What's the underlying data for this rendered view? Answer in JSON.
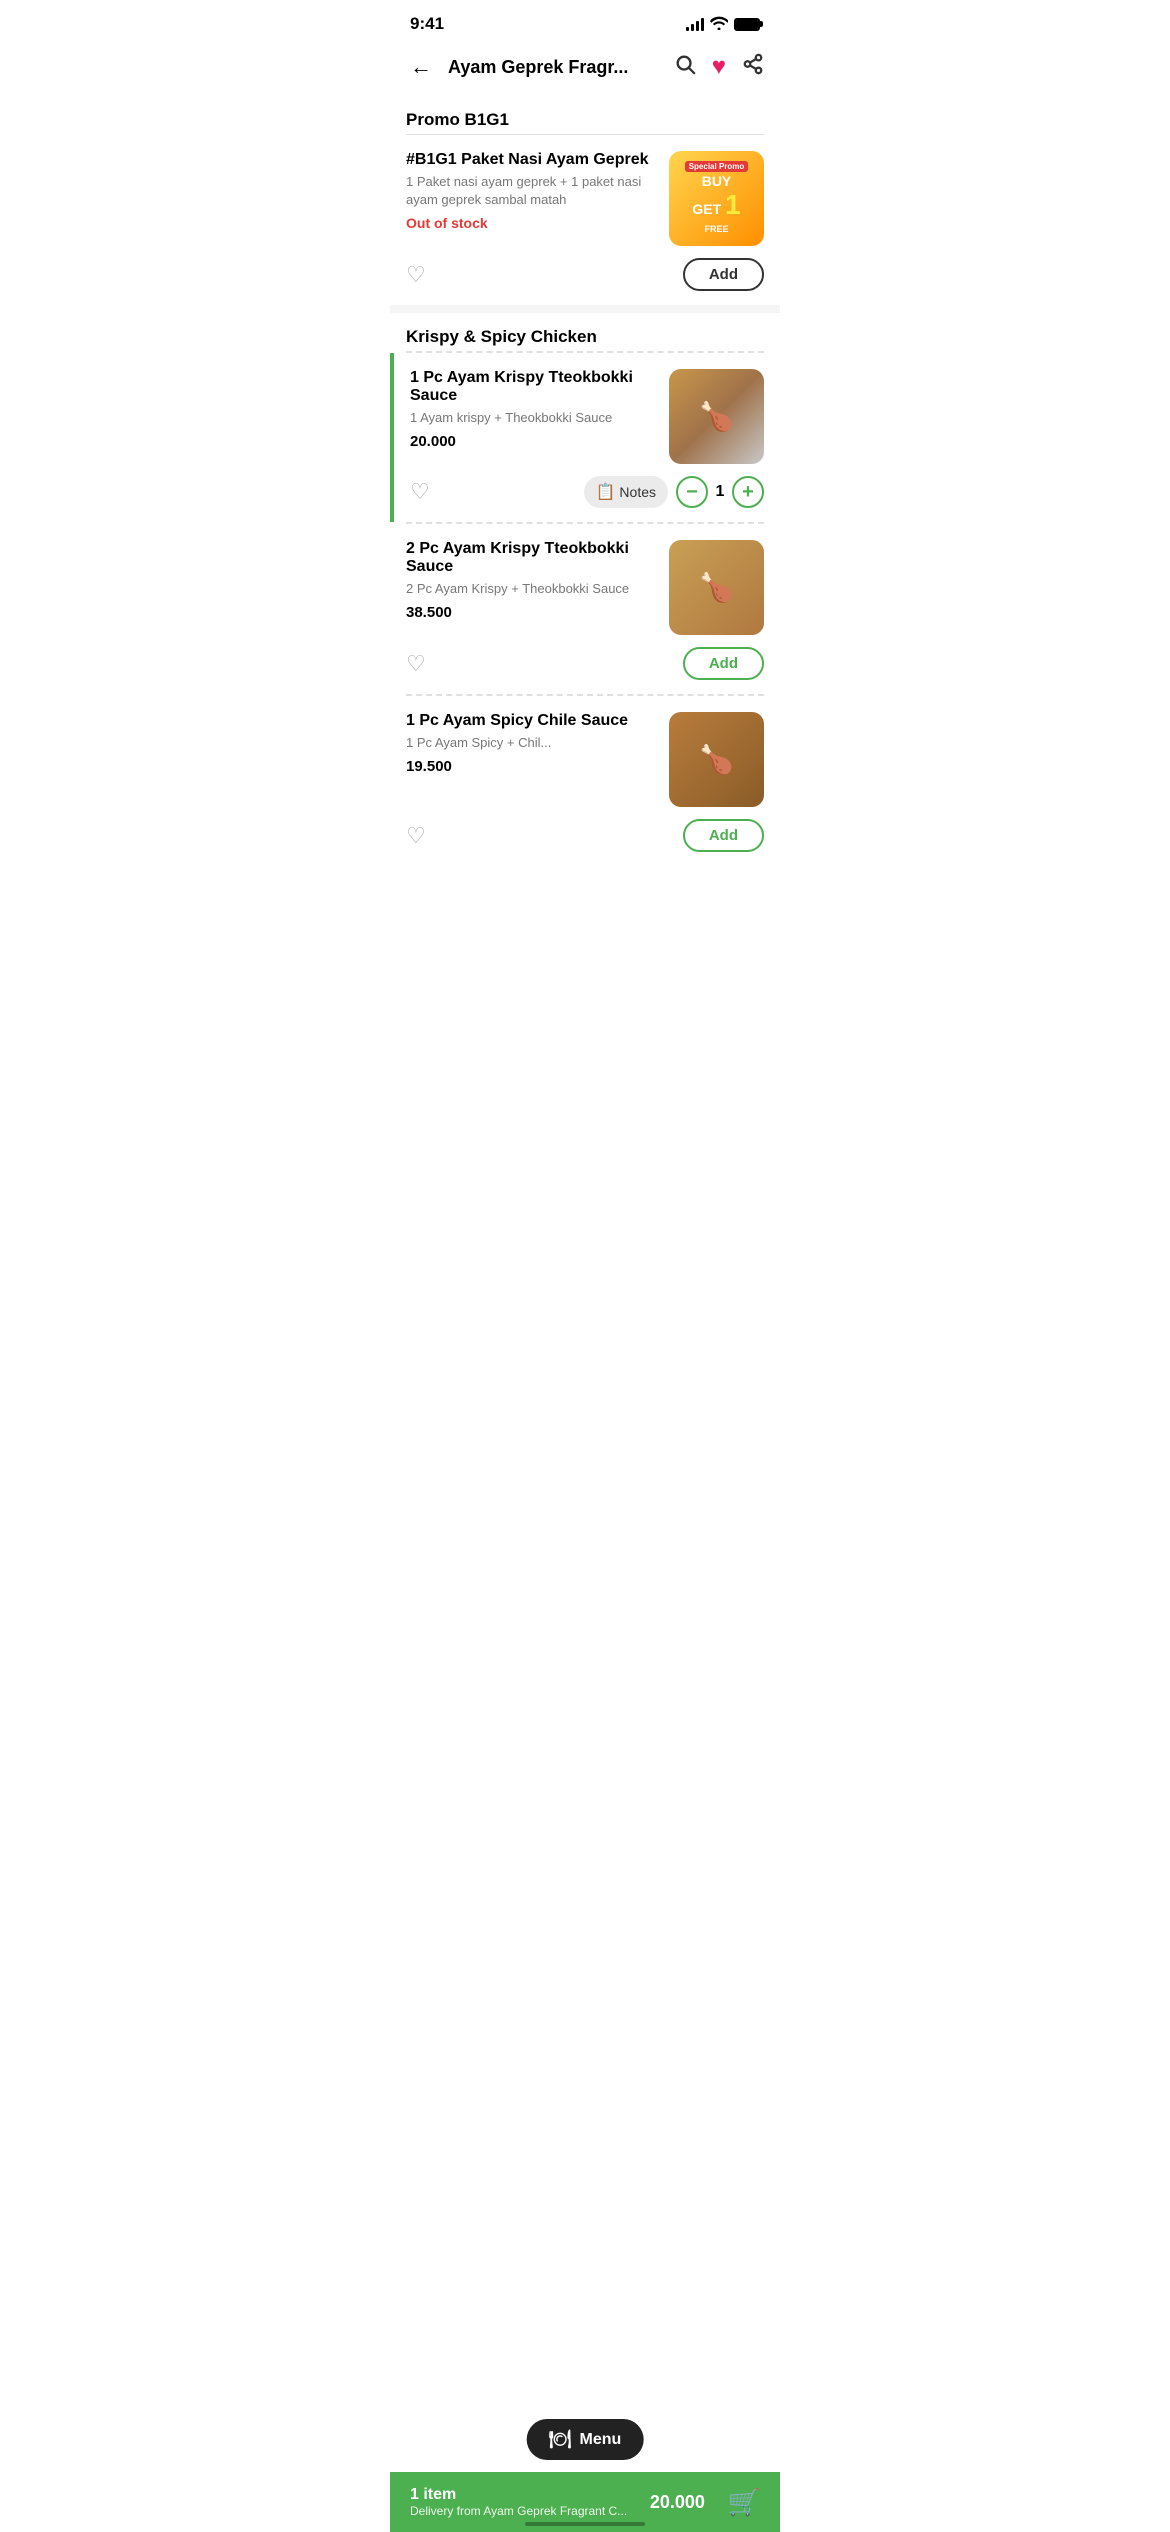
{
  "status": {
    "time": "9:41",
    "battery_full": true
  },
  "header": {
    "title": "Ayam Geprek Fragr...",
    "back_label": "←",
    "search_label": "search",
    "heart_label": "favorite",
    "share_label": "share"
  },
  "promo_section": {
    "title": "Promo B1G1",
    "item": {
      "name": "#B1G1 Paket Nasi Ayam Geprek",
      "desc": "1 Paket nasi ayam geprek + 1 paket nasi ayam geprek sambal matah",
      "status": "Out of stock",
      "add_label": "Add",
      "img_special": "Special Promo",
      "img_buy": "BUY",
      "img_get": "GET",
      "img_1": "1",
      "img_free": "FREE"
    }
  },
  "krispy_section": {
    "title": "Krispy & Spicy Chicken",
    "items": [
      {
        "name": "1 Pc Ayam Krispy Tteokbokki Sauce",
        "desc": "1 Ayam krispy + Theokbokki Sauce",
        "price": "20.000",
        "selected": true,
        "notes_label": "Notes",
        "qty": "1",
        "qty_minus": "−",
        "qty_plus": "+"
      },
      {
        "name": "2 Pc Ayam Krispy Tteokbokki Sauce",
        "desc": "2 Pc Ayam Krispy + Theokbokki Sauce",
        "price": "38.500",
        "selected": false,
        "add_label": "Add"
      },
      {
        "name": "1 Pc Ayam Spicy Chile Sauce",
        "desc": "1 Pc Ayam Spicy + Chil...",
        "price": "19.500",
        "selected": false,
        "add_label": "Add"
      }
    ]
  },
  "menu_float": {
    "icon": "🍽",
    "label": "Menu"
  },
  "cart": {
    "items_label": "1 item",
    "delivery_label": "Delivery from Ayam Geprek Fragrant C...",
    "total": "20.000",
    "basket_icon": "🛒"
  }
}
